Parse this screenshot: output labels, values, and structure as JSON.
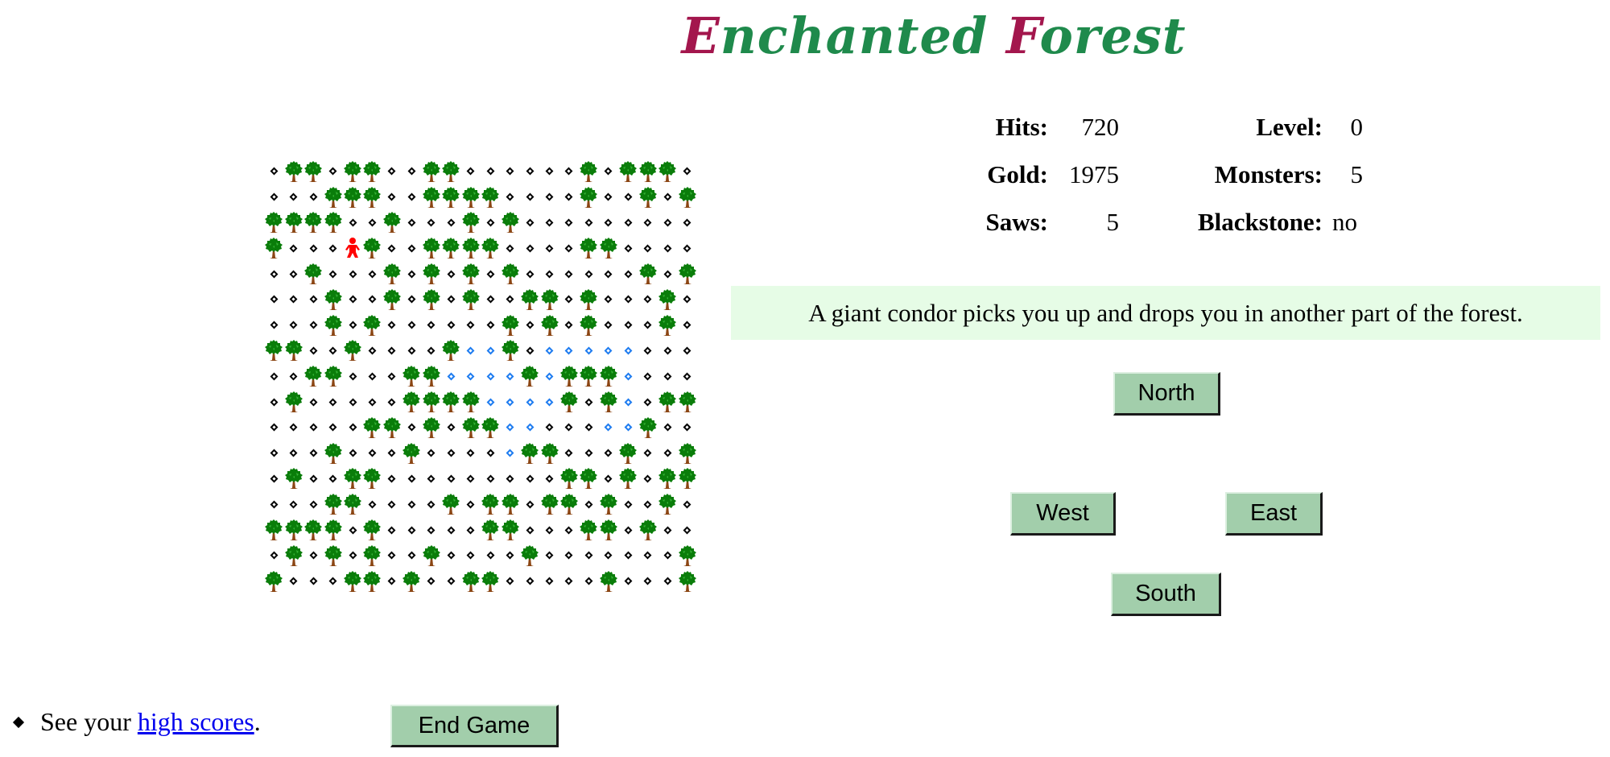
{
  "title": {
    "first_cap": "E",
    "first_rest": "nchanted ",
    "second_cap": "F",
    "second_rest": "orest"
  },
  "stats": {
    "left": [
      {
        "label": "Hits:",
        "value": "720"
      },
      {
        "label": "Gold:",
        "value": "1975"
      },
      {
        "label": "Saws:",
        "value": "5"
      }
    ],
    "right": [
      {
        "label": "Level:",
        "value": "0"
      },
      {
        "label": "Monsters:",
        "value": "5"
      },
      {
        "label": "Blackstone:",
        "value": "no"
      }
    ]
  },
  "message": "A giant condor picks you up and drops you in another part of the forest.",
  "buttons": {
    "north": "North",
    "west": "West",
    "east": "East",
    "south": "South",
    "end_game": "End Game"
  },
  "footer": {
    "prefix": "See your ",
    "link": "high scores",
    "suffix": "."
  },
  "map": {
    "legend": {
      ".": "clearing",
      "T": "tree",
      "b": "visited-clearing",
      "P": "player"
    },
    "rows": [
      ".TT.TT..TT......T.TTT.",
      "...TTT..TTTT....T..T.T",
      "TTTT..T...T.T.........",
      "T...PT..TTTT....TT....",
      "..T...T.T.T.T......T.T",
      "...T..T.T.T..TT.T...T.",
      "...T.T......T.T.T...T.",
      "TT..T....TbbT.bbbbb...",
      "..TT...TTbbbbTbTTTb...",
      ".T.....TTTTbbbbT.Tb.TT",
      ".....TT.T.TTbb...bbT..",
      "...T...T....bTT...T..T",
      ".T..TT.........TT.T.TT",
      "...TT....T.TT.TT.T..T.",
      "TTTT.T.....TT...TT.T..",
      ".T.T.T..T....T.......T",
      "T...TT.T..TT.....T...T"
    ]
  },
  "colors": {
    "title_green": "#1f8a4c",
    "title_red": "#a3164d",
    "button_bg": "#a2ceab",
    "message_bg": "#e6fce6",
    "visited_blue": "#1e7cf0",
    "player_red": "#ff0000",
    "link_blue": "#0000ee"
  }
}
